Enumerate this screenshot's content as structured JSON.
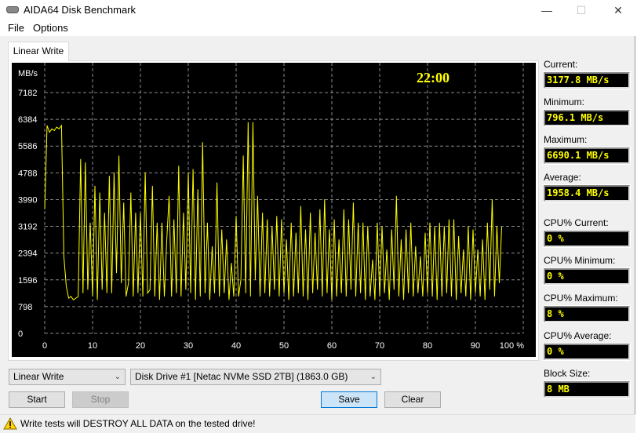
{
  "window": {
    "title": "AIDA64 Disk Benchmark",
    "minimize": "—",
    "maximize": "☐",
    "close": "✕"
  },
  "menu": [
    "File",
    "Options"
  ],
  "tab": "Linear Write",
  "stats": {
    "current_label": "Current:",
    "current": "3177.8 MB/s",
    "minimum_label": "Minimum:",
    "minimum": "796.1 MB/s",
    "maximum_label": "Maximum:",
    "maximum": "6690.1 MB/s",
    "average_label": "Average:",
    "average": "1958.4 MB/s",
    "cpu_current_label": "CPU% Current:",
    "cpu_current": "0 %",
    "cpu_minimum_label": "CPU% Minimum:",
    "cpu_minimum": "0 %",
    "cpu_maximum_label": "CPU% Maximum:",
    "cpu_maximum": "8 %",
    "cpu_average_label": "CPU% Average:",
    "cpu_average": "0 %",
    "block_size_label": "Block Size:",
    "block_size": "8 MB"
  },
  "controls": {
    "test_select": "Linear Write",
    "drive_select": "Disk Drive #1  [Netac NVMe SSD 2TB]  (1863.0 GB)",
    "start": "Start",
    "stop": "Stop",
    "save": "Save",
    "clear": "Clear"
  },
  "status": {
    "icon": "warning-icon",
    "text": "Write tests will DESTROY ALL DATA on the tested drive!"
  },
  "colors": {
    "line": "#ffff00",
    "background": "#000000",
    "grid": "#808080"
  },
  "chart_data": {
    "type": "line",
    "timer": "22:00",
    "ylabel": "MB/s",
    "yticks": [
      "0",
      "798",
      "1596",
      "2394",
      "3192",
      "3990",
      "4788",
      "5586",
      "6384",
      "7182"
    ],
    "xticks": [
      "0",
      "10",
      "20",
      "30",
      "40",
      "50",
      "60",
      "70",
      "80",
      "90",
      "100 %"
    ],
    "xlim": [
      0,
      100
    ],
    "ylim": [
      0,
      7182
    ],
    "x_step": 0.5,
    "values": [
      3700,
      6200,
      6000,
      6100,
      6050,
      6150,
      6100,
      6200,
      2300,
      1400,
      1050,
      1100,
      1000,
      1050,
      1100,
      5200,
      1200,
      5100,
      1300,
      3300,
      1100,
      4400,
      1000,
      4200,
      1300,
      3600,
      1200,
      4700,
      1200,
      4800,
      1800,
      5300,
      1500,
      3900,
      1100,
      1500,
      4200,
      1100,
      3600,
      1200,
      3600,
      1100,
      4800,
      1200,
      1300,
      4400,
      1100,
      3300,
      1000,
      3300,
      1100,
      2800,
      4100,
      1100,
      3400,
      1200,
      5000,
      1100,
      3600,
      1300,
      4800,
      1200,
      4900,
      1000,
      4300,
      1100,
      5700,
      1200,
      3300,
      1000,
      2600,
      1200,
      4500,
      1100,
      3100,
      1200,
      2800,
      1000,
      2100,
      1100,
      3500,
      1100,
      1600,
      5300,
      1200,
      6300,
      1100,
      6300,
      1600,
      4100,
      1100,
      3600,
      1200,
      3400,
      1100,
      3200,
      1300,
      3500,
      1100,
      3400,
      1200,
      2800,
      1000,
      3300,
      1100,
      3000,
      1200,
      3800,
      1100,
      3100,
      1000,
      3600,
      1200,
      3000,
      1300,
      3700,
      1100,
      4000,
      1200,
      3100,
      1000,
      3400,
      1100,
      2800,
      1200,
      3700,
      1100,
      3400,
      1300,
      3900,
      1100,
      3300,
      1200,
      3300,
      1000,
      3200,
      1100,
      2200,
      1000,
      3300,
      1100,
      3200,
      1200,
      2500,
      1000,
      3100,
      1300,
      4100,
      1100,
      2800,
      1000,
      3100,
      1200,
      3300,
      1100,
      2600,
      1200,
      2300,
      1100,
      3000,
      1200,
      3300,
      1100,
      3200,
      1000,
      3300,
      1100,
      3200,
      1200,
      3400,
      1100,
      3400,
      1000,
      2900,
      1200,
      2500,
      1100,
      3200,
      1000,
      3100,
      1200,
      2500,
      1100,
      2800,
      1000,
      3300,
      1300,
      4000,
      1100,
      3200,
      1500,
      3177
    ]
  }
}
